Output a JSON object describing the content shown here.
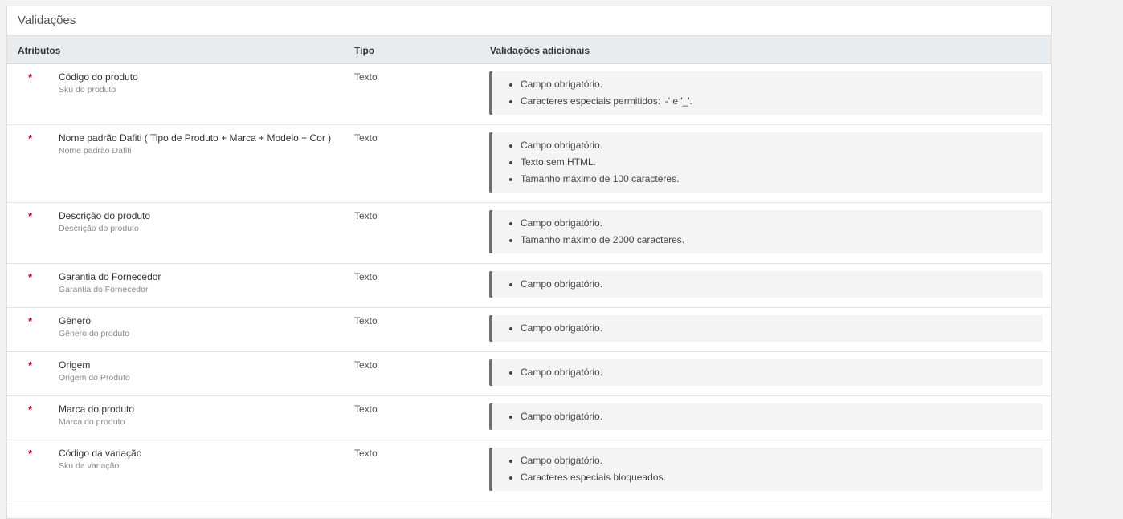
{
  "panel": {
    "title": "Validações"
  },
  "table": {
    "headers": {
      "attributes": "Atributos",
      "type": "Tipo",
      "validations": "Validações adicionais"
    },
    "required_mark": "*",
    "rows": [
      {
        "name": "Código do produto",
        "subtitle": "Sku do produto",
        "type": "Texto",
        "validations": [
          "Campo obrigatório.",
          "Caracteres especiais permitidos: '-' e '_'."
        ]
      },
      {
        "name": "Nome padrão Dafiti ( Tipo de Produto + Marca + Modelo + Cor )",
        "subtitle": "Nome padrão Dafiti",
        "type": "Texto",
        "validations": [
          "Campo obrigatório.",
          "Texto sem HTML.",
          "Tamanho máximo de 100 caracteres."
        ]
      },
      {
        "name": "Descrição do produto",
        "subtitle": "Descrição do produto",
        "type": "Texto",
        "validations": [
          "Campo obrigatório.",
          "Tamanho máximo de 2000 caracteres."
        ]
      },
      {
        "name": "Garantia do Fornecedor",
        "subtitle": "Garantia do Fornecedor",
        "type": "Texto",
        "validations": [
          "Campo obrigatório."
        ]
      },
      {
        "name": "Gênero",
        "subtitle": "Gênero do produto",
        "type": "Texto",
        "validations": [
          "Campo obrigatório."
        ]
      },
      {
        "name": "Origem",
        "subtitle": "Origem do Produto",
        "type": "Texto",
        "validations": [
          "Campo obrigatório."
        ]
      },
      {
        "name": "Marca do produto",
        "subtitle": "Marca do produto",
        "type": "Texto",
        "validations": [
          "Campo obrigatório."
        ]
      },
      {
        "name": "Código da variação",
        "subtitle": "Sku da variação",
        "type": "Texto",
        "validations": [
          "Campo obrigatório.",
          "Caracteres especiais bloqueados."
        ]
      }
    ]
  }
}
